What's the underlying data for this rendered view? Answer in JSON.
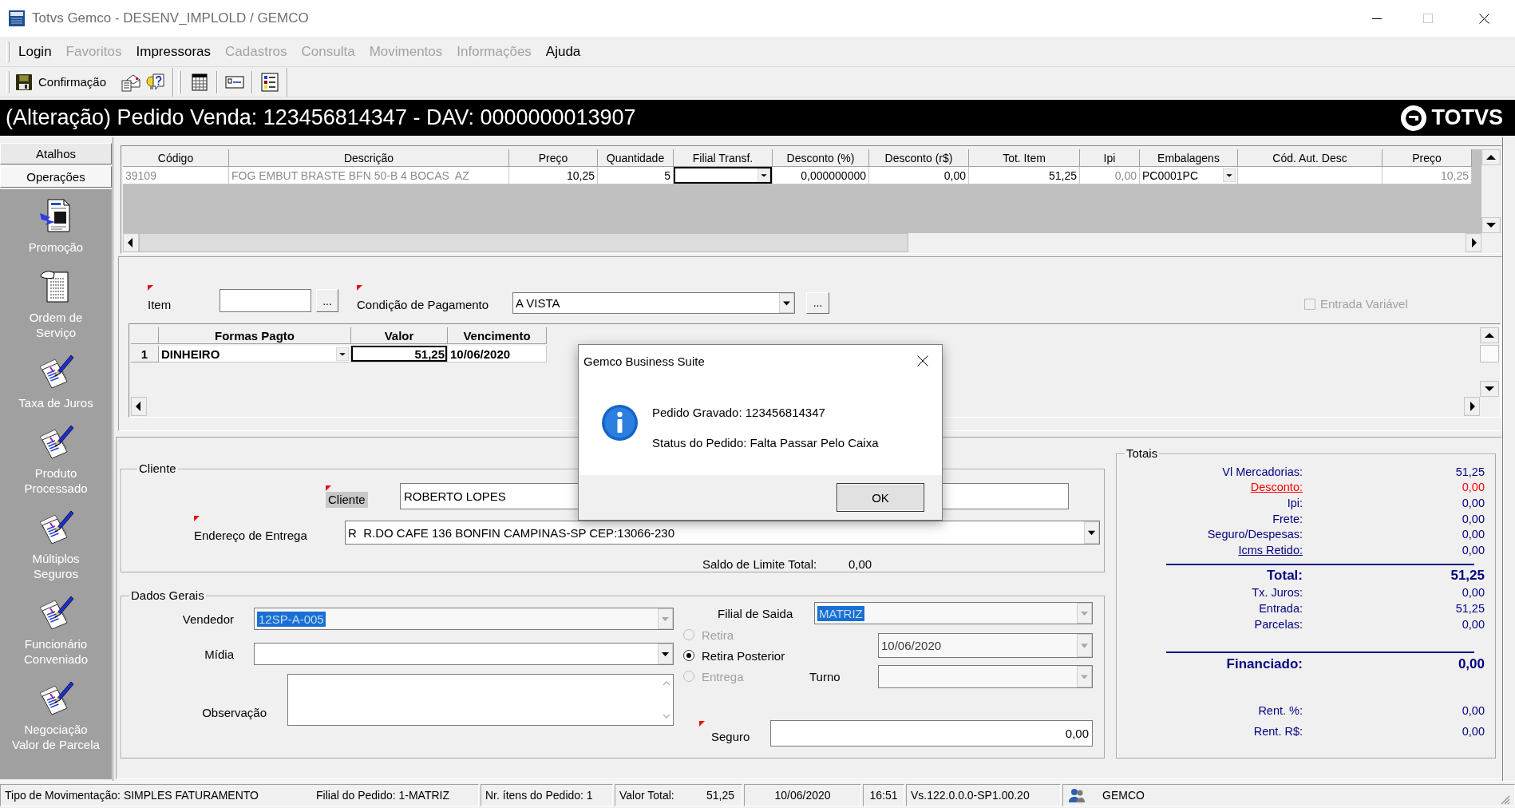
{
  "window": {
    "title": "Totvs Gemco - DESENV_IMPLOLD / GEMCO",
    "maximize_disabled": true
  },
  "menu": [
    {
      "label": "Login",
      "disabled": false
    },
    {
      "label": "Favoritos",
      "disabled": true
    },
    {
      "label": "Impressoras",
      "disabled": false
    },
    {
      "label": "Cadastros",
      "disabled": true
    },
    {
      "label": "Consulta",
      "disabled": true
    },
    {
      "label": "Movimentos",
      "disabled": true
    },
    {
      "label": "Informações",
      "disabled": true
    },
    {
      "label": "Ajuda",
      "disabled": false
    }
  ],
  "toolbar": {
    "groups": [
      [
        {
          "kind": "save",
          "label": "Confirmação"
        },
        {
          "kind": "document"
        },
        {
          "kind": "help"
        }
      ],
      [
        {
          "kind": "calendar"
        },
        {
          "kind": "card"
        },
        {
          "kind": "list"
        }
      ]
    ]
  },
  "header": {
    "title": "(Alteração) Pedido Venda: 123456814347 - DAV: 0000000013907",
    "logo": "TOTVS"
  },
  "sidebar": {
    "tabs": [
      {
        "label": "Atalhos",
        "selected": false
      },
      {
        "label": "Operações",
        "selected": true
      }
    ],
    "items": [
      {
        "label": "Promoção",
        "kind": "promotion"
      },
      {
        "label": "Ordem de\nServiço",
        "kind": "ledger"
      },
      {
        "label": "Taxa de Juros",
        "kind": "pen"
      },
      {
        "label": "Produto\nProcessado",
        "kind": "pen"
      },
      {
        "label": "Múltiplos\nSeguros",
        "kind": "pen"
      },
      {
        "label": "Funcionário\nConveniado",
        "kind": "pen"
      },
      {
        "label": "Negociação\nValor de Parcela",
        "kind": "pen"
      }
    ]
  },
  "items_grid": {
    "columns": [
      {
        "label": "Código",
        "kind": "readonly_text"
      },
      {
        "label": "Descrição",
        "kind": "readonly_text"
      },
      {
        "label": "Preço",
        "kind": "number"
      },
      {
        "label": "Quantidade",
        "kind": "number"
      },
      {
        "label": "Filial Transf.",
        "kind": "combo"
      },
      {
        "label": "Desconto (%)",
        "kind": "number"
      },
      {
        "label": "Desconto (r$)",
        "kind": "number"
      },
      {
        "label": "Tot. Item",
        "kind": "number"
      },
      {
        "label": "Ipi",
        "kind": "readonly_number"
      },
      {
        "label": "Embalagens",
        "kind": "combo"
      },
      {
        "label": "Cód. Aut. Desc",
        "kind": "text"
      },
      {
        "label": "Preço",
        "kind": "readonly_number"
      }
    ],
    "rows": [
      {
        "cells": [
          {
            "text": "39109",
            "focused": false
          },
          {
            "text": "FOG EMBUT BRASTE BFN 50-B 4 BOCAS  AZ",
            "focused": false
          },
          {
            "text": "10,25",
            "focused": false
          },
          {
            "text": "5",
            "focused": false
          },
          {
            "focused": true
          },
          {
            "text": "0,000000000",
            "focused": false
          },
          {
            "text": "0,00",
            "focused": false
          },
          {
            "text": "51,25",
            "focused": false
          },
          {
            "text": "0,00",
            "focused": false
          },
          {
            "text": "PC0001PC",
            "focused": false
          },
          {
            "focused": false
          },
          {
            "text": "10,25",
            "focused": false
          }
        ]
      }
    ]
  },
  "payment": {
    "item": {
      "label": "Item",
      "required": true,
      "button": "..."
    },
    "condition": {
      "label": "Condição de Pagamento",
      "value": "A VISTA",
      "required": true,
      "button": "..."
    },
    "variable_entry": {
      "label": "Entrada Variável",
      "checked": false,
      "disabled": true
    },
    "grid": {
      "columns": [
        {
          "label": "Formas Pagto",
          "kind": "combo"
        },
        {
          "label": "Valor",
          "kind": "number"
        },
        {
          "label": "Vencimento",
          "kind": "text"
        }
      ],
      "rows": [
        {
          "number": "1",
          "cells": [
            {
              "text": "DINHEIRO",
              "focused": false
            },
            {
              "text": "51,25",
              "focused": true
            },
            {
              "text": "10/06/2020",
              "focused": false
            }
          ]
        }
      ]
    }
  },
  "client": {
    "title": "Cliente",
    "name": {
      "label": "Cliente",
      "value": "ROBERTO LOPES",
      "required": true
    },
    "address": {
      "label": "Endereço de Entrega",
      "value": "R  R.DO CAFE 136 BONFIN CAMPINAS-SP CEP:13066-230",
      "required": true
    },
    "credit": {
      "label": "Saldo de Limite Total:",
      "value": "0,00"
    }
  },
  "general": {
    "title": "Dados Gerais",
    "seller": {
      "label": "Vendedor",
      "value": "12SP-A-005",
      "highlighted": true,
      "disabled": true
    },
    "media": {
      "label": "Mídia",
      "disabled": false
    },
    "notes": {
      "label": "Observação"
    },
    "branch": {
      "label": "Filial de Saida",
      "value": "MATRIZ",
      "highlighted": true,
      "disabled": true
    },
    "delivery": [
      {
        "label": "Retira",
        "selected": false,
        "disabled": true
      },
      {
        "label": "Retira Posterior",
        "selected": true,
        "disabled": false
      },
      {
        "label": "Entrega",
        "selected": false,
        "disabled": true
      }
    ],
    "date": {
      "value": "10/06/2020",
      "disabled": true
    },
    "shift": {
      "label": "Turno",
      "disabled": true
    },
    "insurance": {
      "label": "Seguro",
      "value": "0,00",
      "required": true
    }
  },
  "totals": {
    "title": "Totais",
    "sections": [
      {
        "rows": [
          {
            "label": "Vl Mercadorias:",
            "value": "51,25",
            "kind": "plain"
          },
          {
            "label": "Desconto:",
            "value": "0,00",
            "kind": "warning_link"
          },
          {
            "label": "Ipi:",
            "value": "0,00",
            "kind": "plain"
          },
          {
            "label": "Frete:",
            "value": "0,00",
            "kind": "plain"
          },
          {
            "label": "Seguro/Despesas:",
            "value": "0,00",
            "kind": "plain"
          },
          {
            "label": "Icms Retido:",
            "value": "0,00",
            "kind": "link"
          }
        ],
        "rule_after": true
      },
      {
        "rows": [
          {
            "label": "Total:",
            "value": "51,25",
            "kind": "total"
          },
          {
            "label": "Tx. Juros:",
            "value": "0,00",
            "kind": "plain"
          },
          {
            "label": "Entrada:",
            "value": "51,25",
            "kind": "plain"
          },
          {
            "label": "Parcelas:",
            "value": "0,00",
            "kind": "plain"
          }
        ],
        "rule_after": true
      },
      {
        "rows": [
          {
            "label": "Financiado:",
            "value": "0,00",
            "kind": "total"
          }
        ],
        "rule_after": false
      },
      {
        "rows": [
          {
            "label": "Rent. %:",
            "value": "0,00",
            "kind": "plain"
          },
          {
            "label": "Rent. R$:",
            "value": "0,00",
            "kind": "plain"
          }
        ],
        "rule_after": false
      }
    ]
  },
  "status_bar": [
    {
      "kind": "text",
      "texts": [
        "Tipo de Movimentação: SIMPLES FATURAMENTO",
        "Filial do Pedido: 1-MATRIZ"
      ]
    },
    {
      "kind": "text",
      "texts": [
        "Nr. ítens do Pedido: 1"
      ]
    },
    {
      "kind": "text",
      "texts": [
        "Valor Total:",
        "51,25"
      ]
    },
    {
      "kind": "text",
      "texts": [
        "10/06/2020"
      ]
    },
    {
      "kind": "text",
      "texts": [
        "16:51"
      ]
    },
    {
      "kind": "text",
      "texts": [
        "Vs.122.0.0.0-SP1.00.20"
      ]
    },
    {
      "kind": "user",
      "texts": [
        "GEMCO"
      ]
    }
  ],
  "dialog": {
    "title": "Gemco Business Suite",
    "lines": [
      "Pedido Gravado: 123456814347",
      "Status do Pedido: Falta Passar Pelo Caixa"
    ],
    "button": "OK"
  }
}
